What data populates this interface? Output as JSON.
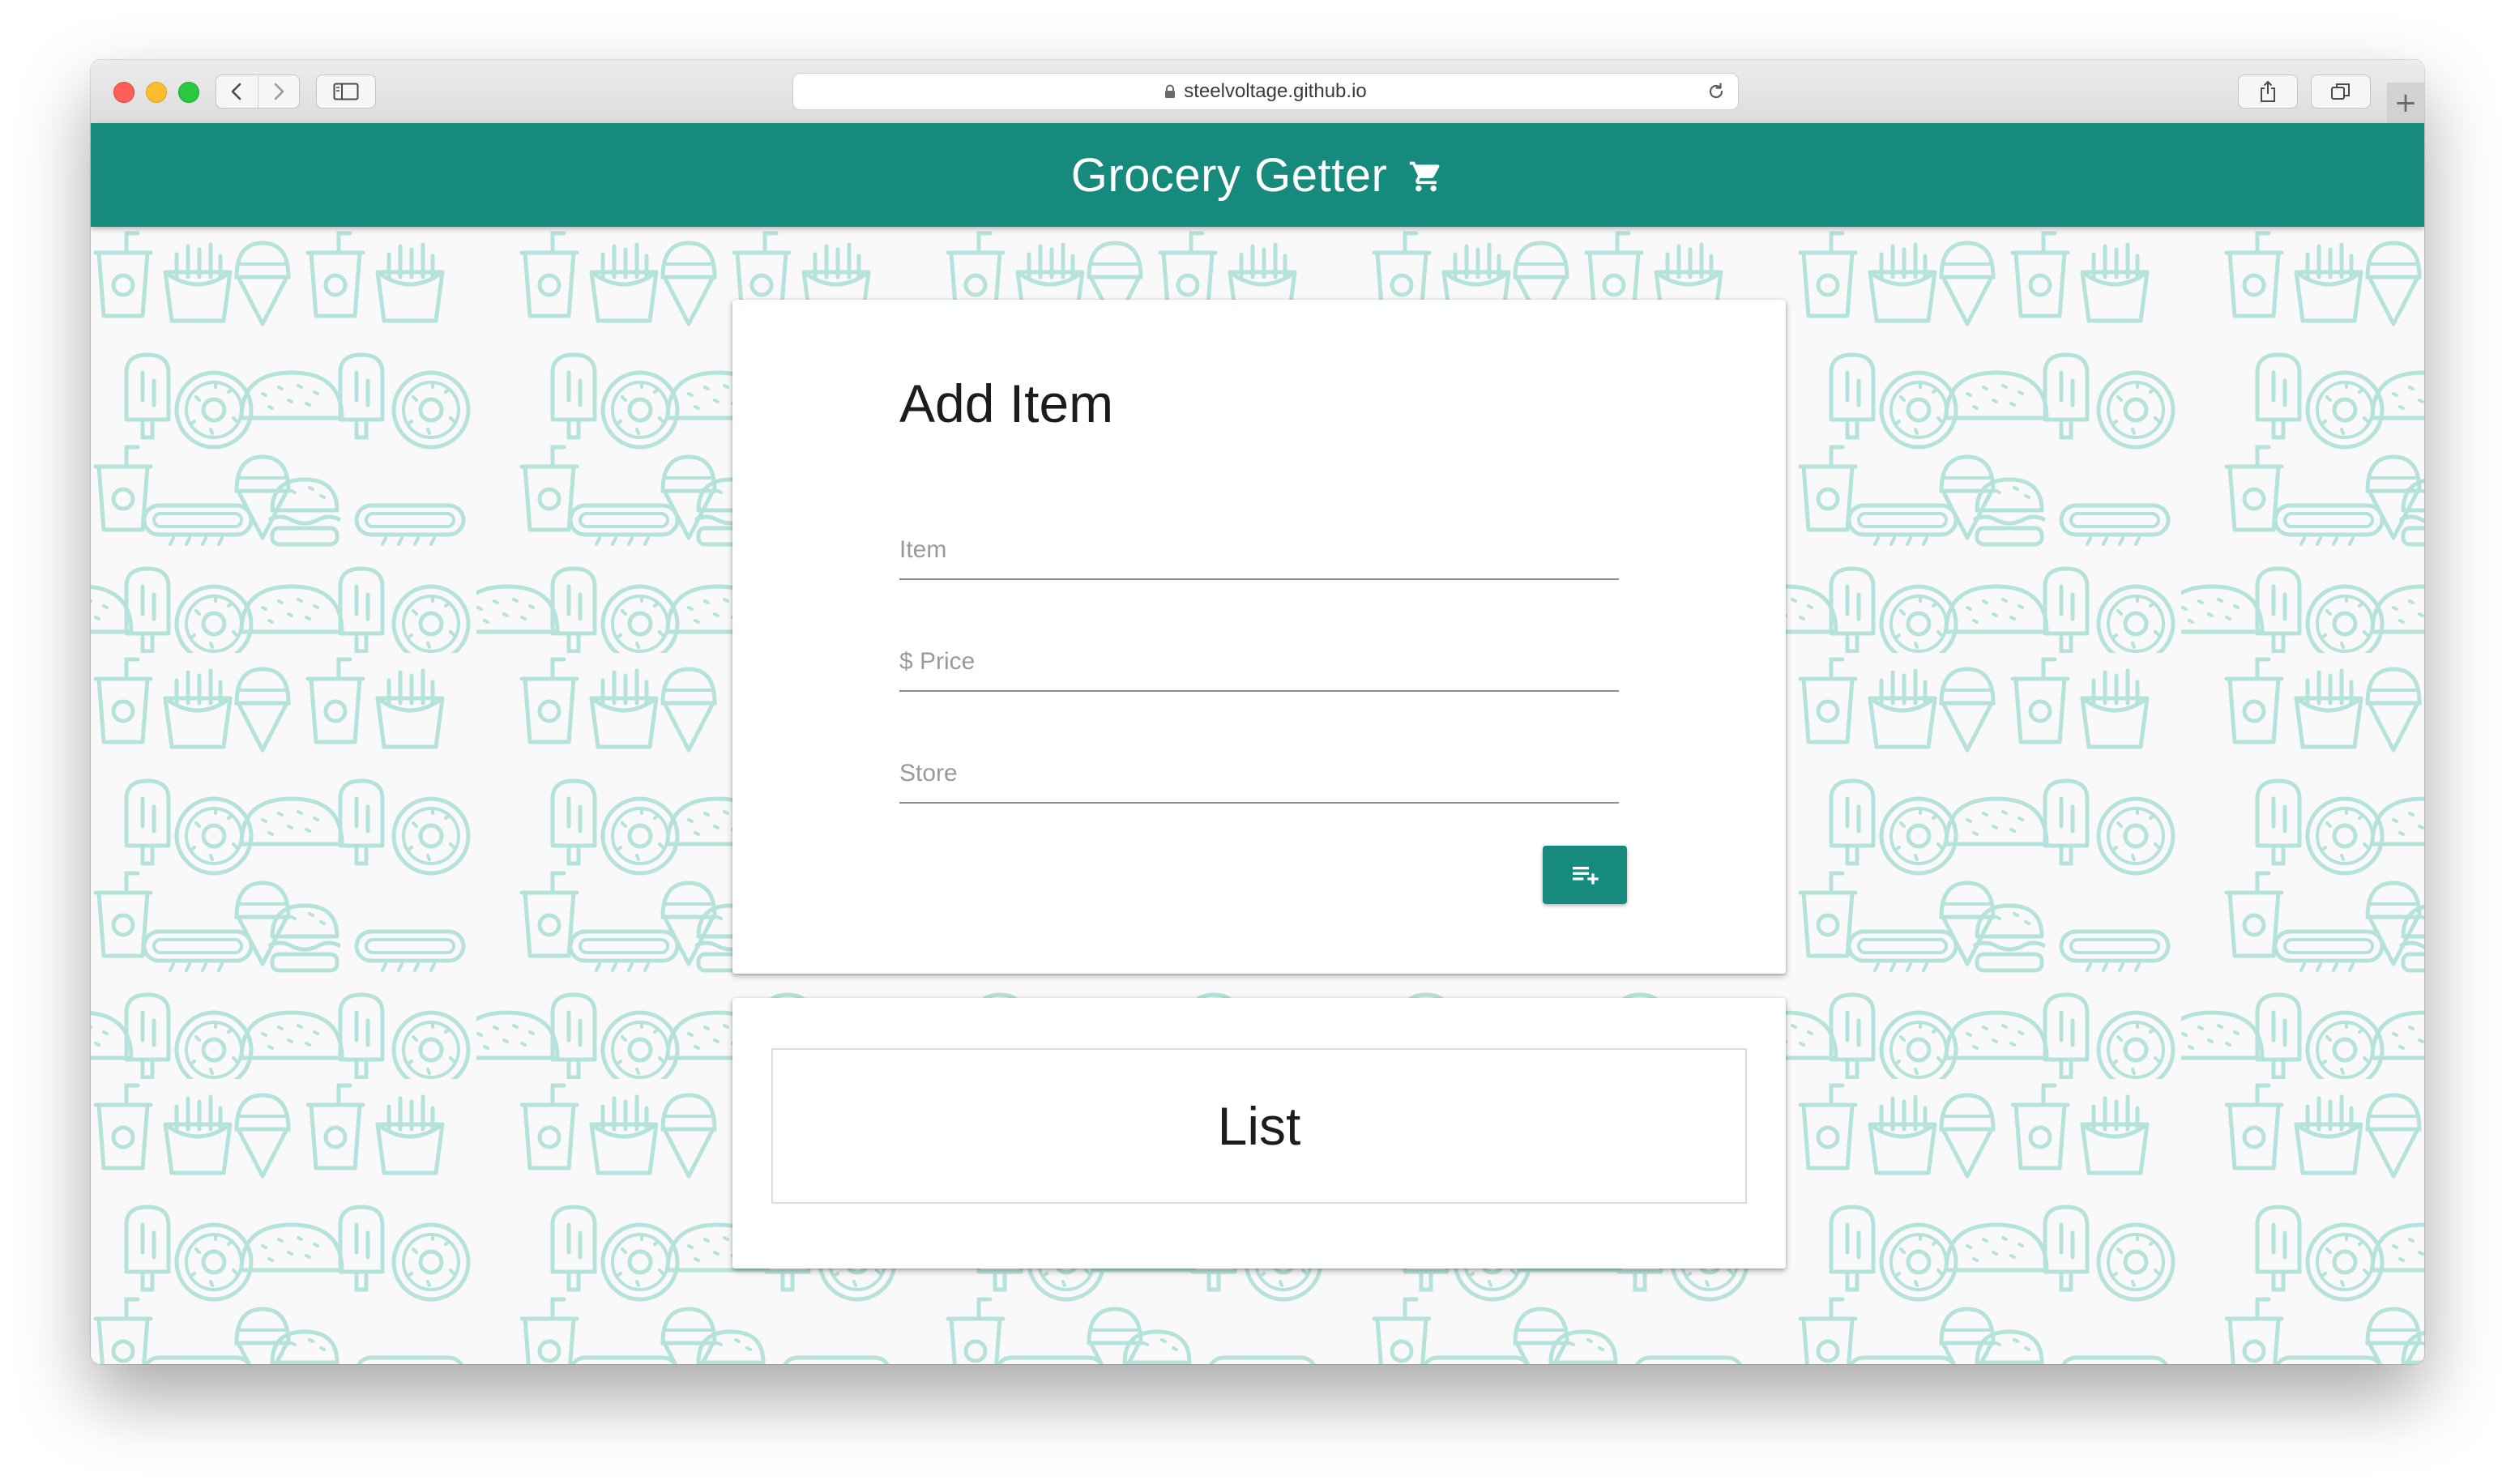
{
  "browser": {
    "url": "steelvoltage.github.io",
    "new_tab_label": "+"
  },
  "header": {
    "title": "Grocery Getter",
    "icon": "cart-icon",
    "color": "#168a7c"
  },
  "add_item": {
    "title": "Add Item",
    "fields": [
      {
        "placeholder": "Item",
        "value": ""
      },
      {
        "placeholder": "$ Price",
        "value": ""
      },
      {
        "placeholder": "Store",
        "value": ""
      }
    ],
    "add_button_icon": "playlist-add-icon"
  },
  "list": {
    "title": "List"
  },
  "background": {
    "pattern_color": "#b5e2da",
    "icons": [
      "soda-cup-icon",
      "fries-icon",
      "ice-cream-cone-icon",
      "popsicle-icon",
      "donut-icon",
      "taco-icon",
      "hot-dog-icon",
      "burger-icon"
    ]
  }
}
